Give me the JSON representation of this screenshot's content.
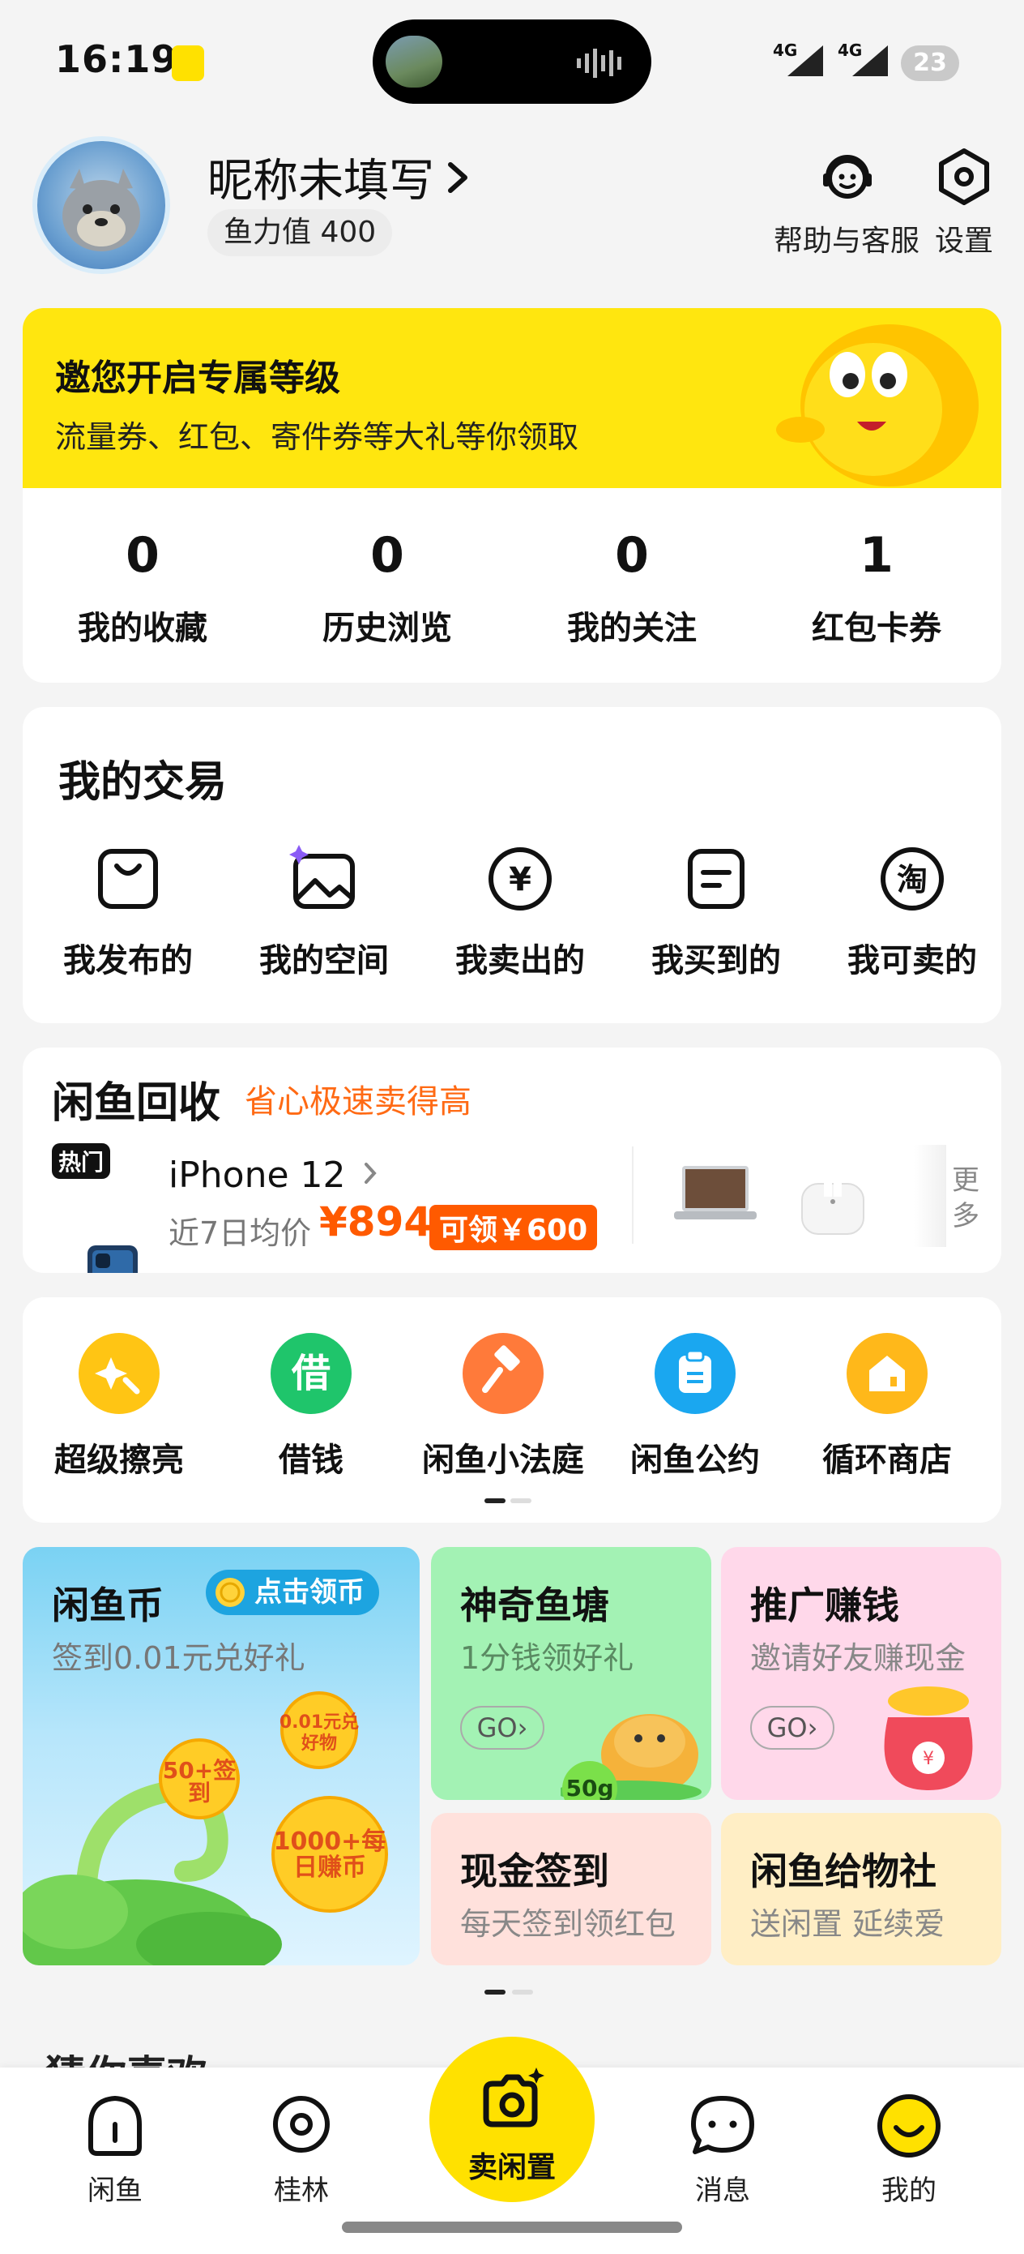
{
  "status": {
    "time": "16:19",
    "signal1": "4G",
    "signal2": "4G",
    "battery": "23"
  },
  "profile": {
    "nickname": "昵称未填写",
    "fish_power": "鱼力值 400"
  },
  "top_actions": {
    "help": "帮助与客服",
    "settings": "设置"
  },
  "vip": {
    "title": "邀您开启专属等级",
    "subtitle": "流量券、红包、寄件券等大礼等你领取"
  },
  "stats": [
    {
      "value": "0",
      "label": "我的收藏"
    },
    {
      "value": "0",
      "label": "历史浏览"
    },
    {
      "value": "0",
      "label": "我的关注"
    },
    {
      "value": "1",
      "label": "红包卡券"
    }
  ],
  "trades": {
    "title": "我的交易",
    "items": [
      {
        "label": "我发布的",
        "icon": "bag-icon"
      },
      {
        "label": "我的空间",
        "icon": "image-icon"
      },
      {
        "label": "我卖出的",
        "icon": "yuan-icon"
      },
      {
        "label": "我买到的",
        "icon": "receipt-icon"
      },
      {
        "label": "我可卖的",
        "icon": "taobao-icon"
      }
    ]
  },
  "recycle": {
    "title": "闲鱼回收",
    "slogan": "省心极速卖得高",
    "hot_tag": "热门",
    "product": "iPhone 12",
    "avg_label": "近7日均价",
    "avg_price": "¥894",
    "coupon": "可领￥600",
    "more": "更多"
  },
  "services": [
    {
      "label": "超级擦亮",
      "color": "#ffc514",
      "icon": "sparkle-icon"
    },
    {
      "label": "借钱",
      "color": "#1fc56b",
      "icon": "borrow-icon",
      "glyph": "借"
    },
    {
      "label": "闲鱼小法庭",
      "color": "#ff7a3a",
      "icon": "gavel-icon"
    },
    {
      "label": "闲鱼公约",
      "color": "#1aa7f0",
      "icon": "clipboard-icon"
    },
    {
      "label": "循环商店",
      "color": "#ffb81a",
      "icon": "store-icon"
    }
  ],
  "tiles": {
    "coin": {
      "title": "闲鱼币",
      "subtitle": "签到0.01元兑好礼",
      "button": "点击领币",
      "coins": [
        "0.01元兑好物",
        "50+签到",
        "1000+每日赚币"
      ]
    },
    "pond": {
      "title": "神奇鱼塘",
      "subtitle": "1分钱领好礼",
      "go": "GO",
      "badge": "50g"
    },
    "promo": {
      "title": "推广赚钱",
      "subtitle": "邀请好友赚现金",
      "go": "GO"
    },
    "cash": {
      "title": "现金签到",
      "subtitle": "每天签到领红包"
    },
    "give": {
      "title": "闲鱼给物社",
      "subtitle": "送闲置 延续爱"
    }
  },
  "guess_title": "猜你喜欢",
  "tabbar": {
    "home": "闲鱼",
    "nearby": "桂林",
    "sell": "卖闲置",
    "messages": "消息",
    "mine": "我的"
  },
  "colors": {
    "brand_yellow": "#ffe100",
    "accent_orange": "#ff5a00"
  }
}
